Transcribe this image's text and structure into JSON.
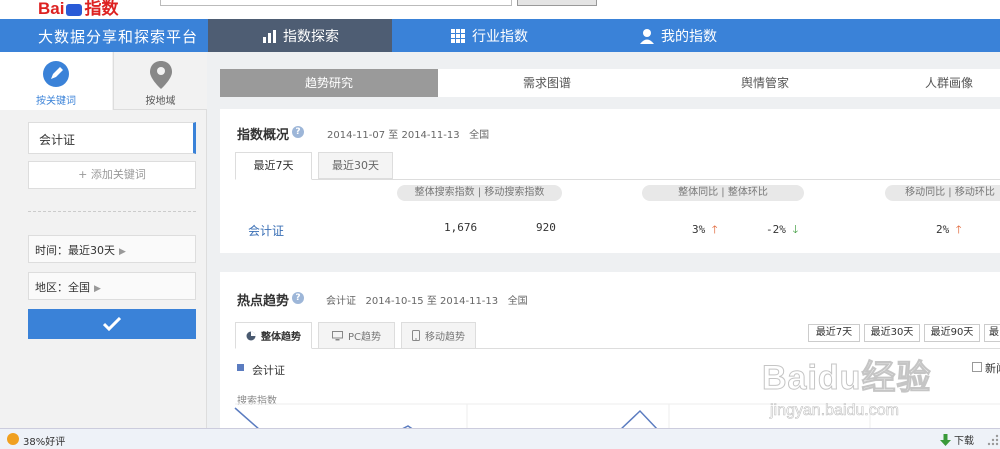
{
  "top": {
    "logo_text": "Bai",
    "logo_suffix": "指数"
  },
  "nav": {
    "brand": "大数据分享和探索平台",
    "tabs": [
      {
        "label": "指数探索",
        "icon": "bar-chart-icon",
        "active": true
      },
      {
        "label": "行业指数",
        "icon": "grid-icon",
        "active": false
      },
      {
        "label": "我的指数",
        "icon": "user-icon",
        "active": false
      }
    ]
  },
  "sidebar": {
    "tabs": [
      {
        "label": "按关键词",
        "icon": "pen-icon",
        "active": true
      },
      {
        "label": "按地域",
        "icon": "map-pin-icon",
        "active": false
      }
    ],
    "keyword": "会计证",
    "add_keyword": "添加关键词",
    "time_filter": "时间：最近30天",
    "region_filter": "地区：全国"
  },
  "subtabs": [
    "趋势研究",
    "需求图谱",
    "舆情管家",
    "人群画像"
  ],
  "overview": {
    "title": "指数概况",
    "date_range": "2014-11-07 至 2014-11-13",
    "region": "全国",
    "tabs": [
      "最近7天",
      "最近30天"
    ],
    "col_search": "整体搜索指数 | 移动搜索指数",
    "col_yoy": "整体同比 | 整体环比",
    "col_mobile": "移动同比 | 移动环比",
    "row": {
      "keyword": "会计证",
      "overall_index": "1,676",
      "mobile_index": "920",
      "overall_yoy": "3%",
      "overall_qoq": "-2%",
      "mobile_yoy": "2%"
    }
  },
  "hot": {
    "title": "热点趋势",
    "keyword": "会计证",
    "date_range": "2014-10-15 至 2014-11-13",
    "region": "全国",
    "tabs": [
      "整体趋势",
      "PC趋势",
      "移动趋势"
    ],
    "ranges": [
      "最近7天",
      "最近30天",
      "最近90天",
      "最近半年"
    ],
    "legend": "会计证",
    "news_label": "新闻",
    "ylabel": "搜索指数"
  },
  "status": {
    "rating": "38%好评",
    "download": "下载"
  },
  "watermark": {
    "text": "Baidu经验",
    "url": "jingyan.baidu.com"
  },
  "colors": {
    "accent": "#3a82d8",
    "nav_active": "#4e5d73",
    "up": "#e06030",
    "down": "#3a9a3a"
  }
}
